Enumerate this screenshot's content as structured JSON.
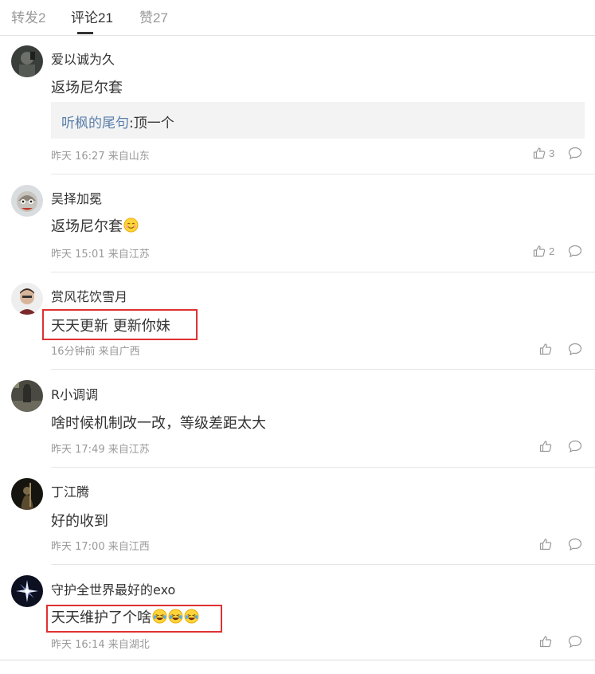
{
  "tabs": [
    {
      "label": "转发",
      "count": "2"
    },
    {
      "label": "评论",
      "count": "21"
    },
    {
      "label": "赞",
      "count": "27"
    }
  ],
  "comments": [
    {
      "user": "爱以诚为久",
      "text": "返场尼尔套",
      "reply_user": "听枫的尾句",
      "reply_text": ":顶一个",
      "meta": "昨天 16:27 来自山东",
      "likes": "3"
    },
    {
      "user": "吴择加冕",
      "text": "返场尼尔套",
      "emoji": "smile-emoji",
      "meta": "昨天 15:01 来自江苏",
      "likes": "2"
    },
    {
      "user": "赏风花饮雪月",
      "text": "天天更新 更新你妹",
      "meta": "16分钟前 来自广西",
      "likes": ""
    },
    {
      "user": "R小调调",
      "text": "啥时候机制改一改，等级差距太大",
      "meta": "昨天 17:49 来自江苏",
      "likes": ""
    },
    {
      "user": "丁江腾",
      "text": "好的收到",
      "meta": "昨天 17:00 来自江西",
      "likes": ""
    },
    {
      "user": "守护全世界最好的exo",
      "text": "天天维护了个啥",
      "emoji": "laugh-cry-emoji",
      "meta": "昨天 16:14 来自湖北",
      "likes": ""
    }
  ],
  "colors": {
    "highlight": "#e03131",
    "link": "#5a7fab"
  }
}
